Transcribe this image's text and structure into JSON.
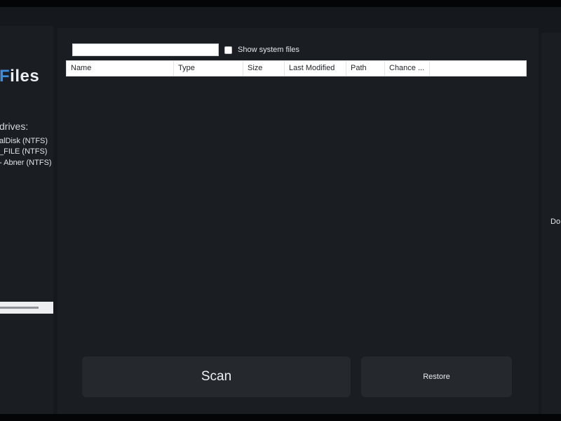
{
  "app": {
    "logo_accent": "F",
    "logo_rest": "iles"
  },
  "sidebar": {
    "drives_label": "drives:",
    "drives": [
      {
        "label": "alDisk (NTFS)"
      },
      {
        "label": "_FILE (NTFS)"
      },
      {
        "label": " - Abner  (NTFS)"
      }
    ],
    "progress_fraction": 0.73
  },
  "search": {
    "value": "",
    "placeholder": ""
  },
  "options": {
    "show_system_files_label": "Show system files",
    "show_system_files_checked": false
  },
  "table": {
    "columns": [
      "Name",
      "Type",
      "Size",
      "Last Modified",
      "Path",
      "Chance ..."
    ],
    "rows": []
  },
  "actions": {
    "scan_label": "Scan",
    "restore_label": "Restore"
  },
  "right_panel": {
    "label": "Do"
  },
  "colors": {
    "accent": "#3d8cdd",
    "background": "#15181d",
    "panel": "#1a1d22",
    "button": "#25282d"
  }
}
